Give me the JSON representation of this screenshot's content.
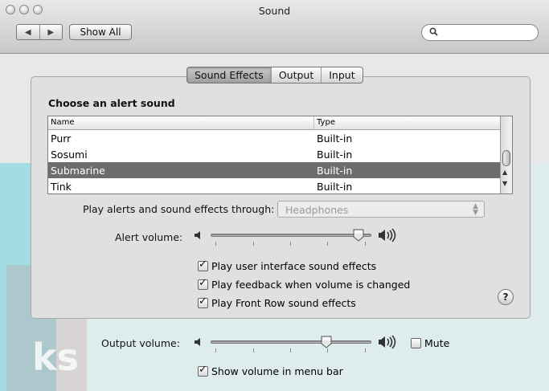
{
  "window": {
    "title": "Sound"
  },
  "toolbar": {
    "show_all_label": "Show All",
    "back_icon": "back-arrow-icon",
    "forward_icon": "forward-arrow-icon",
    "search_placeholder": ""
  },
  "tabs": [
    {
      "label": "Sound Effects",
      "selected": true
    },
    {
      "label": "Output",
      "selected": false
    },
    {
      "label": "Input",
      "selected": false
    }
  ],
  "alert_section": {
    "heading": "Choose an alert sound",
    "columns": [
      "Name",
      "Type"
    ],
    "rows": [
      {
        "name": "Purr",
        "type": "Built-in",
        "selected": false
      },
      {
        "name": "Sosumi",
        "type": "Built-in",
        "selected": false
      },
      {
        "name": "Submarine",
        "type": "Built-in",
        "selected": true
      },
      {
        "name": "Tink",
        "type": "Built-in",
        "selected": false
      }
    ]
  },
  "play_through": {
    "label": "Play alerts and sound effects through:",
    "value": "Headphones"
  },
  "alert_volume": {
    "label": "Alert volume:",
    "level": 0.92
  },
  "checkboxes": [
    {
      "label": "Play user interface sound effects",
      "checked": true
    },
    {
      "label": "Play feedback when volume is changed",
      "checked": true
    },
    {
      "label": "Play Front Row sound effects",
      "checked": true
    }
  ],
  "help": {
    "label": "?"
  },
  "output_volume": {
    "label": "Output volume:",
    "level": 0.72,
    "mute_label": "Mute",
    "mute_checked": false
  },
  "menu_bar": {
    "label": "Show volume in menu bar",
    "checked": true
  },
  "colors": {
    "selection": "#6d6d6d",
    "watermark": "#12b3c4"
  }
}
